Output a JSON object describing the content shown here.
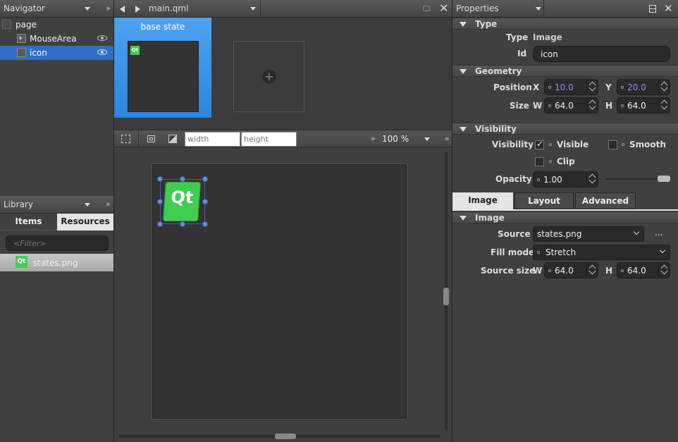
{
  "navigator": {
    "title": "Navigator",
    "items": [
      {
        "label": "page"
      },
      {
        "label": "MouseArea"
      },
      {
        "label": "icon"
      }
    ]
  },
  "library": {
    "title": "Library",
    "tabs": [
      "Items",
      "Resources"
    ],
    "filter_placeholder": "<Filter>",
    "resources": [
      {
        "label": "states.png"
      }
    ]
  },
  "editor": {
    "file": "main.qml",
    "states": {
      "base_label": "base state"
    },
    "toolbar": {
      "width_placeholder": "width",
      "height_placeholder": "height",
      "zoom": "100 %"
    }
  },
  "properties": {
    "title": "Properties",
    "type_section": {
      "title": "Type",
      "type_label": "Type",
      "type_value": "Image",
      "id_label": "Id",
      "id_value": "icon"
    },
    "geometry": {
      "title": "Geometry",
      "position_label": "Position",
      "x_label": "X",
      "x_value": "10.0",
      "y_label": "Y",
      "y_value": "20.0",
      "size_label": "Size",
      "w_label": "W",
      "w_value": "64.0",
      "h_label": "H",
      "h_value": "64.0"
    },
    "visibility": {
      "title": "Visibility",
      "label": "Visibility",
      "visible": "Visible",
      "smooth": "Smooth",
      "clip": "Clip",
      "opacity_label": "Opacity",
      "opacity_value": "1.00",
      "opacity_fraction": 1.0
    },
    "tabs": [
      "Image",
      "Layout",
      "Advanced"
    ],
    "image": {
      "title": "Image",
      "source_label": "Source",
      "source_value": "states.png",
      "more": "...",
      "fill_label": "Fill mode",
      "fill_value": "Stretch",
      "srcsize_label": "Source size",
      "w_label": "W",
      "w_value": "64.0",
      "h_label": "H",
      "h_value": "64.0"
    }
  },
  "colors": {
    "accent": "#3d8ee6",
    "qt_green": "#41cd52",
    "selection": "#2e70c8"
  }
}
